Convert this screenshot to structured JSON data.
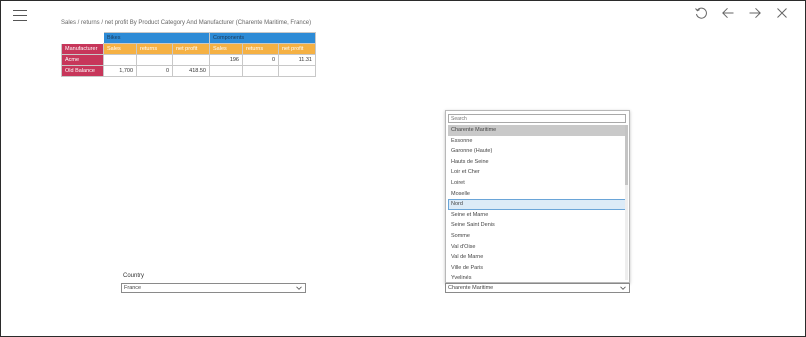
{
  "report_title": "Sales / returns / net profit By Product Category And Manufacturer (Charente Maritime, France)",
  "table": {
    "manufacturer_header": "Manufacturer",
    "groups": [
      "Bikes",
      "Components"
    ],
    "columns": [
      "Sales",
      "returns",
      "net profit",
      "Sales",
      "returns",
      "net profit"
    ],
    "rows": [
      {
        "label": "Acme",
        "cells": [
          "",
          "",
          "",
          "196",
          "0",
          "11.31"
        ]
      },
      {
        "label": "Old Balance",
        "cells": [
          "1,700",
          "0",
          "418.50",
          "",
          "",
          ""
        ]
      }
    ]
  },
  "filters": {
    "country_label": "Country",
    "country_value": "France",
    "department_value": "Charente Maritime"
  },
  "dropdown": {
    "search_placeholder": "Search",
    "selected": "Charente Maritime",
    "hovered": "Nord",
    "items": [
      "Charente Maritime",
      "Essonne",
      "Garonne (Haute)",
      "Hauts de Seine",
      "Loir et Cher",
      "Loiret",
      "Moselle",
      "Nord",
      "Seine et Marne",
      "Seine Saint Denis",
      "Somme",
      "Val d'Oise",
      "Val de Marne",
      "Ville de Paris",
      "Yvelinés"
    ]
  },
  "icons": {
    "menu": "hamburger-menu-icon",
    "refresh": "refresh-icon",
    "back": "arrow-left-icon",
    "forward": "arrow-right-icon",
    "close": "close-icon"
  }
}
